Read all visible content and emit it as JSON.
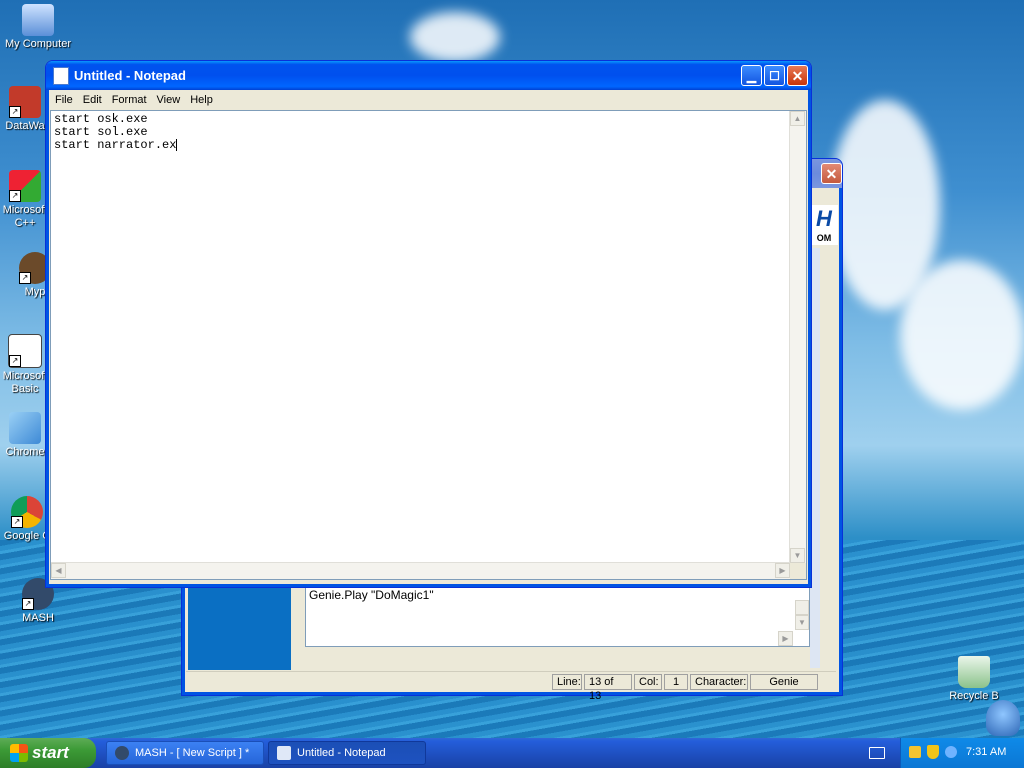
{
  "desktop": {
    "icons": [
      {
        "label": "My Computer"
      },
      {
        "label": "DataWa"
      },
      {
        "label": "Microsoft\nC++"
      },
      {
        "label": "Myp"
      },
      {
        "label": "Microsoft\nBasic"
      },
      {
        "label": "Chrome"
      },
      {
        "label": "Google C"
      },
      {
        "label": "MASH"
      },
      {
        "label": "Recycle B"
      }
    ]
  },
  "notepad": {
    "title": "Untitled - Notepad",
    "menu": [
      "File",
      "Edit",
      "Format",
      "View",
      "Help"
    ],
    "lines": [
      "start osk.exe",
      "start sol.exe",
      "start narrator.ex"
    ]
  },
  "mash": {
    "title_fragment": "H",
    "subtitle_fragment": "OM",
    "code_line": "Genie.Play \"DoMagic1\"",
    "status": {
      "line_label": "Line:",
      "line_value": "13 of 13",
      "col_label": "Col:",
      "col_value": "1",
      "char_label": "Character:",
      "char_value": "Genie"
    }
  },
  "taskbar": {
    "start_label": "start",
    "tasks": [
      {
        "label": "MASH - [ New Script ] *"
      },
      {
        "label": "Untitled - Notepad"
      }
    ],
    "clock": "7:31 AM"
  }
}
